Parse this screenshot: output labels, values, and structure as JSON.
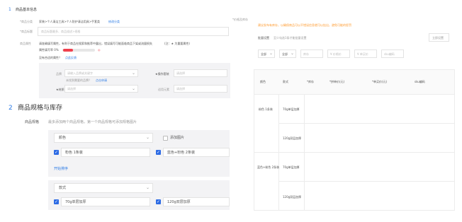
{
  "section1": {
    "number": "1",
    "title": "商品基本信息",
    "rows": [
      {
        "label": "*商品分类",
        "value": "家装>个人清洁工具>个人防护清洁用具>手套类",
        "link": "修改分类"
      },
      {
        "label": "*商品标题",
        "placeholder": "商品标题最多、商品描述>规格"
      },
      {
        "label": "商品属性",
        "value": "请准确填写属性，有利于商品在搜索和推荐中露出，错误填写可能面临商品下架或流量损失",
        "legend": "(注：★ 为重要属性)"
      }
    ],
    "completion_label": "属性填写率 0%",
    "tip_text": "没有合适的属性？",
    "tip_link": "点此反馈",
    "attrs": {
      "brand_label": "品牌",
      "brand_placeholder": "请输入品牌或关键字",
      "brand_hint": "未找到需要的品牌？",
      "brand_hint_link": "点击申请",
      "material_label": "★材质",
      "material_placeholder": "请选择",
      "origin_label": "★操作套装",
      "origin_placeholder": "请选择",
      "extra_label": "适用元素",
      "extra_placeholder": "请选择"
    }
  },
  "section2": {
    "number": "2",
    "title": "商品规格与库存",
    "spec_label": "商品规格",
    "spec_hint": "最多添加两个商品规格，第一个商品规格可添加规格图片",
    "spec1": {
      "name": "颜色",
      "add_image_label": "添加图片",
      "options": [
        "粉色 1条装",
        "蓝色+粉色 2条装"
      ]
    },
    "sort_link": "开始排序",
    "spec2": {
      "name": "款式",
      "options": [
        "70g单层加厚",
        "120g双层加厚"
      ]
    }
  },
  "right_panel": {
    "partial_label": "*价格及库存",
    "notice": "建议发布有库存，以确保商品可以不错误信息就可以挂出，避免可能的惩罚",
    "bulk_label": "批量设置",
    "bulk_hint": "至少勾选1条才能批量设置",
    "apply_button": "立即设置",
    "filters": [
      {
        "label": "全部",
        "type": "select"
      },
      {
        "label": "全部",
        "type": "select"
      },
      {
        "label": "库存",
        "type": "input"
      },
      {
        "label": "¥ 价格价",
        "type": "input"
      },
      {
        "label": "¥ 单买价",
        "type": "input"
      },
      {
        "label": "sku编码",
        "type": "input"
      }
    ],
    "table": {
      "headers": [
        "颜色",
        "款式",
        "*库存",
        "*拼单价(元)",
        "*单买价(元)",
        "sku编码"
      ],
      "groups": [
        {
          "color": "粉色 1条装",
          "rows": [
            "70g单层加厚",
            "120g双层加厚"
          ]
        },
        {
          "color": "蓝色+粉色 2条装",
          "rows": [
            "70g单层加厚",
            "120g双层加厚"
          ]
        }
      ]
    }
  },
  "colors": {
    "accent_blue": "#2d6be4",
    "link_blue": "#2c7be5",
    "notice_orange": "#ff9b2f",
    "required_red": "#f0414e"
  }
}
